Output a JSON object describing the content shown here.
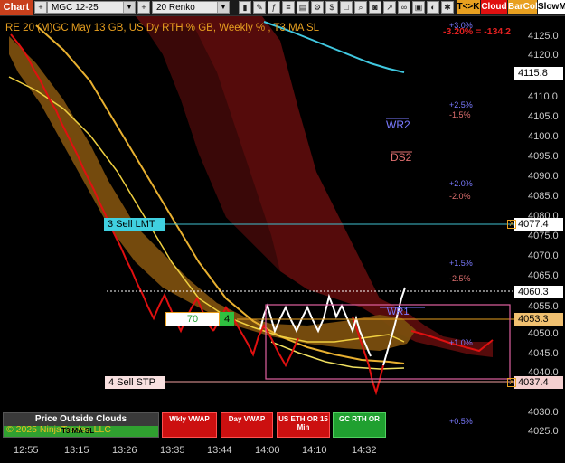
{
  "toolbar": {
    "chart_tab": "Chart",
    "instrument": "MGC 12-25",
    "bar_type": "20 Renko",
    "btn_tk": "T<>K",
    "btn_cloud": "Cloud",
    "btn_barcol": "BarCol",
    "btn_slowm": "SlowM"
  },
  "chart": {
    "title": "RE 20  (M)GC May 13 GB, US Dy RTH % GB, Weekly % , T3 MA SL",
    "pnl": "-3.20% = -134.2",
    "price_ticks": [
      "4125.0",
      "4120.0",
      "4110.0",
      "4105.0",
      "4100.0",
      "4095.0",
      "4090.0",
      "4085.0",
      "4080.0",
      "4075.0",
      "4070.0",
      "4065.0",
      "4055.0",
      "4050.0",
      "4045.0",
      "4040.0",
      "4030.0",
      "4025.0"
    ],
    "time_ticks": [
      "12:55",
      "13:15",
      "13:26",
      "13:35",
      "13:44",
      "14:00",
      "14:10",
      "14:32"
    ],
    "pct_labels": {
      "p30": "+3.0%",
      "p25": "+2.5%",
      "m15": "-1.5%",
      "p20": "+2.0%",
      "m20": "-2.0%",
      "p15": "+1.5%",
      "m25": "-2.5%",
      "p10": "+1.0%",
      "p05": "+0.5%"
    },
    "level_labels": {
      "wr2": "WR2",
      "ds2": "DS2",
      "wr1": "WR1"
    },
    "price_labels": {
      "top": "4115.8",
      "sell_lmt": "4077.4",
      "current": "4060.3",
      "box": "4053.3",
      "sell_stp": "4037.4"
    },
    "orders": {
      "sell_lmt": "3 Sell LMT",
      "sell_stp": "4 Sell STP",
      "qty_box": "70",
      "qty_green": "4"
    },
    "marker_x": "X",
    "panel": {
      "outside_title": "Price Outside Clouds",
      "copyright": "© 2025 NinjaTrader, LLC",
      "ma_sl": "T3 MA SL",
      "wkly_vwap": "Wkly VWAP",
      "day_vwap": "Day VWAP",
      "us_eth_or": "US ETH OR 15 Min",
      "gc_rth_or": "GC RTH OR"
    },
    "colors": {
      "up": "#ffffff",
      "down": "#e01010",
      "cloud_red": "#6a0e0e",
      "cloud_orange": "#8a5a10",
      "accent": "#e8a020"
    }
  }
}
